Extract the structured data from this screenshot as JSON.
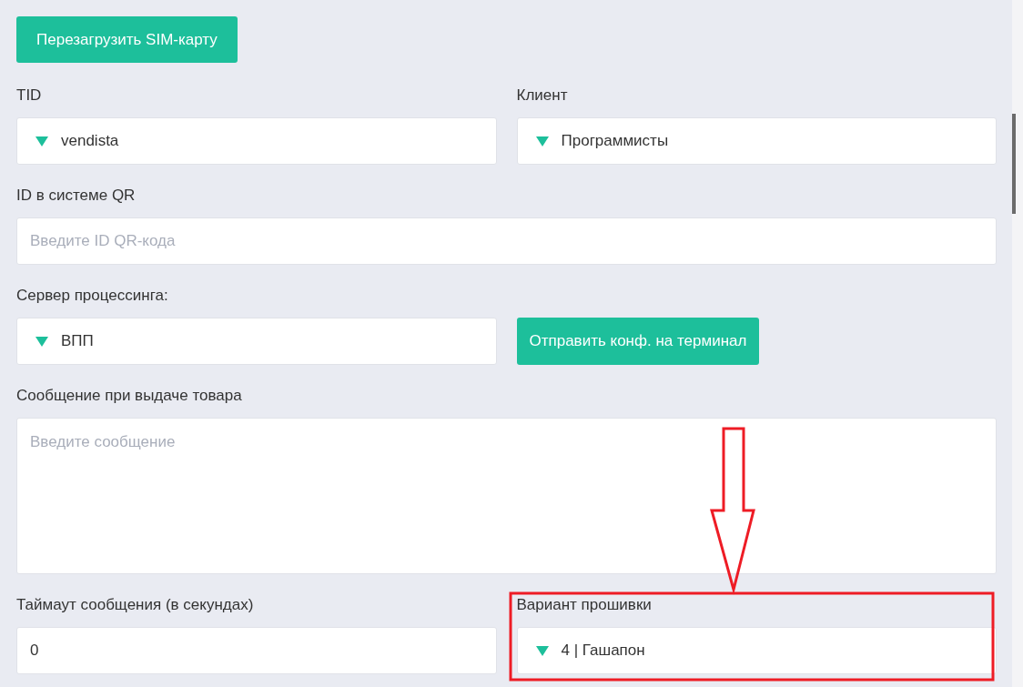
{
  "reload_button": "Перезагрузить SIM-карту",
  "rows": [
    [
      {
        "kind": "dropdown",
        "label": "TID",
        "value": "vendista"
      },
      {
        "kind": "dropdown",
        "label": "Клиент",
        "value": "Программисты"
      }
    ],
    [
      {
        "kind": "input",
        "label": "ID в системе QR",
        "placeholder": "Введите ID QR-кода"
      }
    ],
    [
      {
        "kind": "dropdown",
        "label": "Сервер процессинга:",
        "value": "ВПП"
      },
      {
        "kind": "button",
        "label": "Отправить конф. на терминал"
      }
    ],
    [
      {
        "kind": "textarea",
        "label": "Сообщение при выдаче товара",
        "placeholder": "Введите сообщение"
      }
    ],
    [
      {
        "kind": "input",
        "label": "Таймаут сообщения (в секундах)",
        "value": "0"
      },
      {
        "kind": "dropdown",
        "label": "Вариант прошивки",
        "value": "4 | Гашапон"
      }
    ]
  ]
}
